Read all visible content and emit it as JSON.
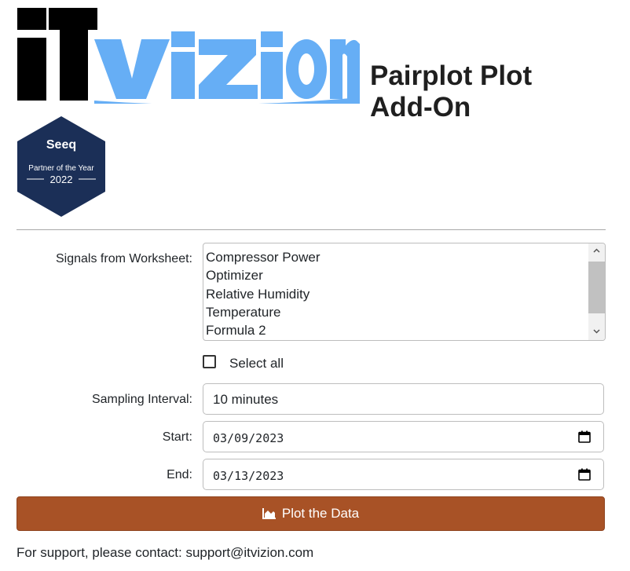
{
  "header": {
    "logo_text": "iTvizion",
    "title_line1": "Pairplot Plot",
    "title_line2": "Add-On"
  },
  "badge": {
    "brand": "Seeq",
    "line": "Partner of the Year",
    "year": "2022",
    "color": "#1b2f57"
  },
  "form": {
    "signals_label": "Signals from Worksheet:",
    "signals": [
      "Compressor Power",
      "Optimizer",
      "Relative Humidity",
      "Temperature",
      "Formula 2"
    ],
    "select_all_label": "Select all",
    "select_all_checked": false,
    "sampling_label": "Sampling Interval:",
    "sampling_value": "10 minutes",
    "start_label": "Start:",
    "start_value": "03/09/2023",
    "end_label": "End:",
    "end_value": "03/13/2023"
  },
  "plot_button": {
    "label": "Plot the Data",
    "icon": "area-chart-icon",
    "color": "#a85226"
  },
  "footer": {
    "support_text": "For support, please contact: support@itvizion.com"
  },
  "colors": {
    "logo_black": "#000000",
    "logo_blue": "#66aef5"
  }
}
